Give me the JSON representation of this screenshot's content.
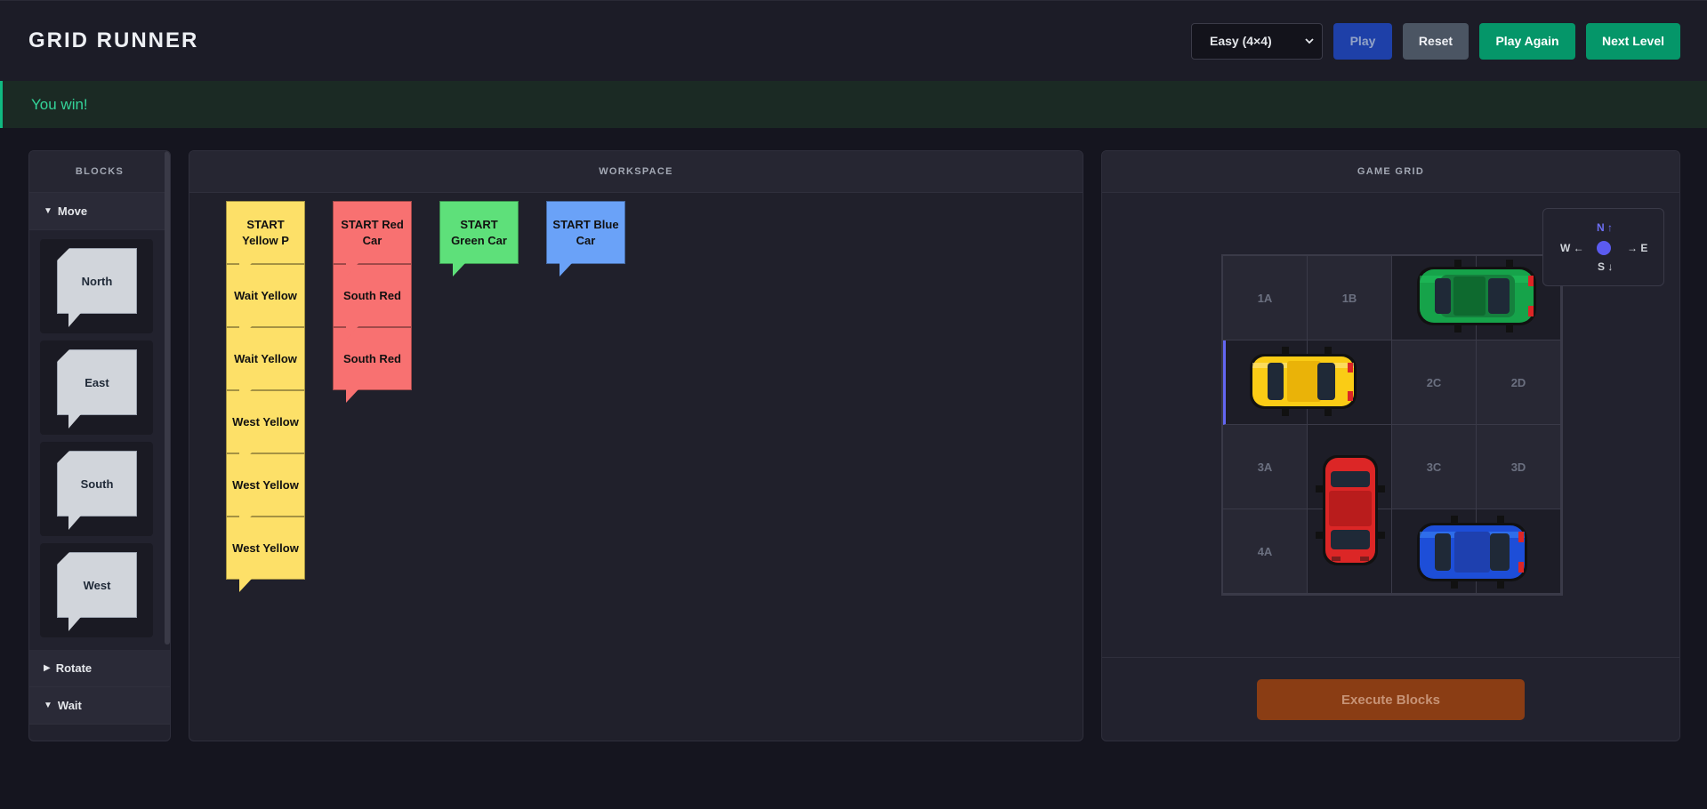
{
  "header": {
    "title": "GRID RUNNER",
    "difficulty": "Easy (4×4)",
    "play": "Play",
    "reset": "Reset",
    "play_again": "Play Again",
    "next_level": "Next Level"
  },
  "banner": {
    "message": "You win!"
  },
  "blocks_panel": {
    "title": "BLOCKS",
    "categories": [
      {
        "label": "Move",
        "expanded": true,
        "items": [
          "North",
          "East",
          "South",
          "West"
        ]
      },
      {
        "label": "Rotate",
        "expanded": false
      },
      {
        "label": "Wait",
        "expanded": true
      }
    ]
  },
  "workspace": {
    "title": "WORKSPACE",
    "stacks": [
      {
        "color": "#fde068",
        "blocks": [
          "START Yellow P",
          "Wait Yellow",
          "Wait Yellow",
          "West Yellow",
          "West Yellow",
          "West Yellow"
        ]
      },
      {
        "color": "#f87171",
        "blocks": [
          "START Red Car",
          "South Red",
          "South Red"
        ]
      },
      {
        "color": "#5ee07a",
        "blocks": [
          "START Green Car"
        ]
      },
      {
        "color": "#6aa2f8",
        "blocks": [
          "START Blue Car"
        ]
      }
    ]
  },
  "game": {
    "title": "GAME GRID",
    "cells": [
      [
        "1A",
        "1B",
        "",
        ""
      ],
      [
        "",
        "",
        "2C",
        "2D"
      ],
      [
        "3A",
        "",
        "3C",
        "3D"
      ],
      [
        "4A",
        "",
        "",
        ""
      ]
    ],
    "compass": {
      "n": "N ↑",
      "s": "S ↓",
      "w": "W ←",
      "e": "→ E"
    },
    "cars": [
      {
        "name": "green-car",
        "color": "#16a34a",
        "row": 1,
        "col": "C-D",
        "orientation": "horizontal"
      },
      {
        "name": "yellow-car",
        "color": "#facc15",
        "row": 2,
        "col": "A-B",
        "orientation": "horizontal"
      },
      {
        "name": "red-car",
        "color": "#dc2626",
        "row": "3-4",
        "col": "B",
        "orientation": "vertical"
      },
      {
        "name": "blue-car",
        "color": "#1d4ed8",
        "row": 4,
        "col": "C-D",
        "orientation": "horizontal"
      }
    ],
    "execute": "Execute Blocks"
  }
}
